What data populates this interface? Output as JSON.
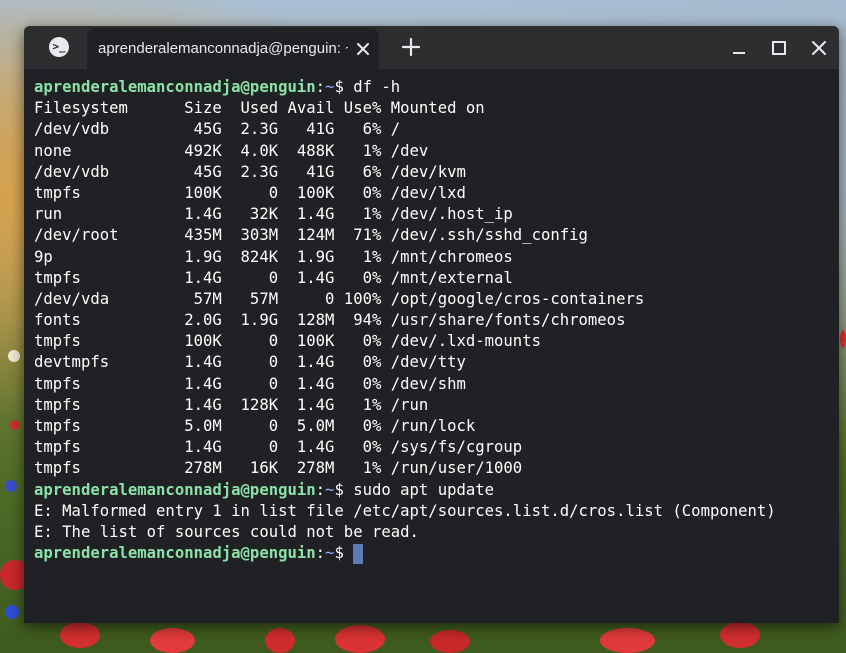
{
  "window": {
    "tab_title": "aprenderalemanconnadja@penguin: ~",
    "app_icon_glyph": ">_"
  },
  "terminal": {
    "prompt_user": "aprenderalemanconnadja@penguin",
    "prompt_sep": ":",
    "prompt_path": "~",
    "prompt_symbol": "$ ",
    "lines": [
      {
        "type": "prompt",
        "cmd": "df -h"
      },
      {
        "type": "out",
        "text": "Filesystem      Size  Used Avail Use% Mounted on"
      },
      {
        "type": "out",
        "text": "/dev/vdb         45G  2.3G   41G   6% /"
      },
      {
        "type": "out",
        "text": "none            492K  4.0K  488K   1% /dev"
      },
      {
        "type": "out",
        "text": "/dev/vdb         45G  2.3G   41G   6% /dev/kvm"
      },
      {
        "type": "out",
        "text": "tmpfs           100K     0  100K   0% /dev/lxd"
      },
      {
        "type": "out",
        "text": "run             1.4G   32K  1.4G   1% /dev/.host_ip"
      },
      {
        "type": "out",
        "text": "/dev/root       435M  303M  124M  71% /dev/.ssh/sshd_config"
      },
      {
        "type": "out",
        "text": "9p              1.9G  824K  1.9G   1% /mnt/chromeos"
      },
      {
        "type": "out",
        "text": "tmpfs           1.4G     0  1.4G   0% /mnt/external"
      },
      {
        "type": "out",
        "text": "/dev/vda         57M   57M     0 100% /opt/google/cros-containers"
      },
      {
        "type": "out",
        "text": "fonts           2.0G  1.9G  128M  94% /usr/share/fonts/chromeos"
      },
      {
        "type": "out",
        "text": "tmpfs           100K     0  100K   0% /dev/.lxd-mounts"
      },
      {
        "type": "out",
        "text": "devtmpfs        1.4G     0  1.4G   0% /dev/tty"
      },
      {
        "type": "out",
        "text": "tmpfs           1.4G     0  1.4G   0% /dev/shm"
      },
      {
        "type": "out",
        "text": "tmpfs           1.4G  128K  1.4G   1% /run"
      },
      {
        "type": "out",
        "text": "tmpfs           5.0M     0  5.0M   0% /run/lock"
      },
      {
        "type": "out",
        "text": "tmpfs           1.4G     0  1.4G   0% /sys/fs/cgroup"
      },
      {
        "type": "out",
        "text": "tmpfs           278M   16K  278M   1% /run/user/1000"
      },
      {
        "type": "prompt",
        "cmd": "sudo apt update"
      },
      {
        "type": "out",
        "text": "E: Malformed entry 1 in list file /etc/apt/sources.list.d/cros.list (Component)"
      },
      {
        "type": "out",
        "text": "E: The list of sources could not be read."
      },
      {
        "type": "prompt",
        "cmd": "",
        "cursor": true
      }
    ]
  },
  "colors": {
    "terminal_bg": "#202124",
    "titlebar_bg": "#2d2e30",
    "prompt_user": "#8ae2a8",
    "prompt_path": "#8ab4f8",
    "cursor": "#5f7bb6"
  },
  "icons": {
    "tab_close": "close-icon",
    "new_tab": "plus-icon",
    "minimize": "minimize-icon",
    "maximize": "maximize-icon",
    "close_window": "close-icon"
  }
}
